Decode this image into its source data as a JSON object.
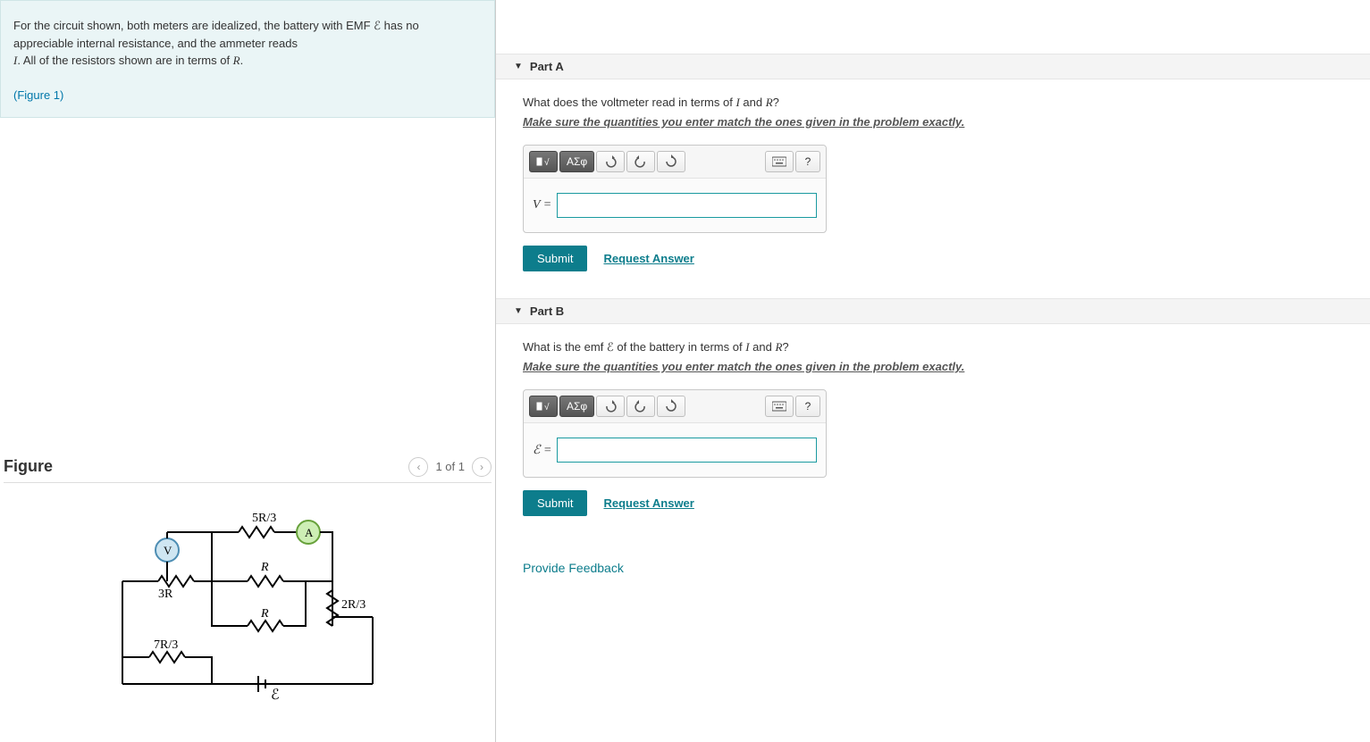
{
  "problem": {
    "text_1": "For the circuit shown, both meters are idealized, the battery with EMF ",
    "emf_sym": "ℰ",
    "text_2": " has no appreciable internal resistance, and the ammeter reads",
    "text_3": ". All of the resistors shown are in terms of ",
    "I_sym": "I",
    "R_sym": "R",
    "period": ".",
    "figure_link": "(Figure 1)"
  },
  "figure": {
    "title": "Figure",
    "page": "1 of 1",
    "labels": {
      "r_5_3": "5R/3",
      "r_top": "R",
      "r_mid": "R",
      "r_3": "3R",
      "r_2_3": "2R/3",
      "r_7_3": "7R/3",
      "emf": "ℰ",
      "voltmeter": "V",
      "ammeter": "A"
    }
  },
  "partA": {
    "title": "Part A",
    "question_1": "What does the voltmeter read in terms of ",
    "I_sym": "I",
    "and": " and ",
    "R_sym": "R",
    "q_end": "?",
    "hint": "Make sure the quantities you enter match the ones given in the problem exactly.",
    "var_label": "V =",
    "submit": "Submit",
    "request": "Request Answer"
  },
  "partB": {
    "title": "Part B",
    "question_1": "What is the emf ",
    "emf_sym": "ℰ",
    "question_2": " of the battery in terms of ",
    "I_sym": "I",
    "and": " and ",
    "R_sym": "R",
    "q_end": "?",
    "hint": "Make sure the quantities you enter match the ones given in the problem exactly.",
    "var_label": "ℰ =",
    "submit": "Submit",
    "request": "Request Answer"
  },
  "toolbar": {
    "greek": "ΑΣφ",
    "help": "?"
  },
  "feedback": "Provide Feedback"
}
